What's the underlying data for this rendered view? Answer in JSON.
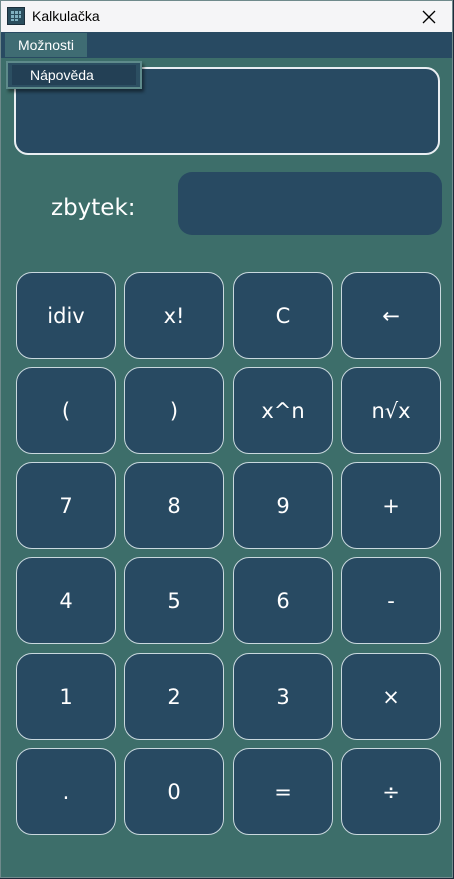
{
  "window": {
    "title": "Kalkulačka",
    "close_symbol": "✕"
  },
  "menu": {
    "options_label": "Možnosti",
    "help_label": "Nápověda"
  },
  "display": {
    "value": ""
  },
  "remainder": {
    "label": "zbytek:",
    "value": ""
  },
  "keypad": {
    "idiv": "idiv",
    "factorial": "x!",
    "clear": "C",
    "backspace": "←",
    "open_paren": "(",
    "close_paren": ")",
    "power": "x^n",
    "root": "n√x",
    "seven": "7",
    "eight": "8",
    "nine": "9",
    "plus": "+",
    "four": "4",
    "five": "5",
    "six": "6",
    "minus": "-",
    "one": "1",
    "two": "2",
    "three": "3",
    "multiply": "×",
    "dot": ".",
    "zero": "0",
    "equals": "=",
    "divide": "÷"
  },
  "colors": {
    "window_bg": "#3d6e6a",
    "button_bg": "#284a62",
    "button_border": "#c9d8de",
    "menubar_bg": "#284a62"
  }
}
